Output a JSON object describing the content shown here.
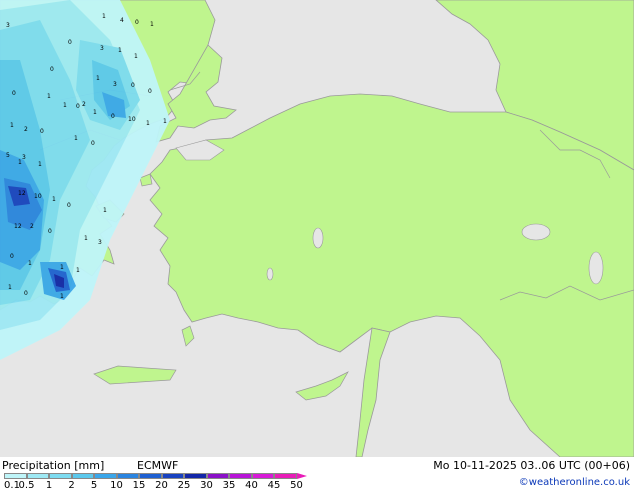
{
  "header": {
    "title": "Precipitation [mm]",
    "model": "ECMWF",
    "valid_time": "Mo 10-11-2025 03..06 UTC (00+06)",
    "credit": "©weatheronline.co.uk"
  },
  "legend": {
    "ticks": [
      "0.1",
      "0.5",
      "1",
      "2",
      "5",
      "10",
      "15",
      "20",
      "25",
      "30",
      "35",
      "40",
      "45",
      "50"
    ],
    "colors": [
      "#bff5f9",
      "#9ee9f4",
      "#7ddbf0",
      "#5bc8ec",
      "#3aa6ea",
      "#2a84e0",
      "#1e60d2",
      "#1842c0",
      "#1226a8",
      "#8a10c8",
      "#b814d8",
      "#d81ad8",
      "#e81cb8"
    ]
  },
  "map": {
    "land_color": "#bff58e",
    "sea_color": "#e6e6e6",
    "border_color": "#9a9a9a",
    "precip_labels": [
      "3",
      "0",
      "1",
      "4",
      "0",
      "1",
      "3",
      "1",
      "1",
      "0",
      "0",
      "1",
      "2",
      "1",
      "0",
      "0",
      "0",
      "3",
      "1",
      "1",
      "0",
      "10",
      "1",
      "1",
      "1",
      "2",
      "0",
      "1",
      "0",
      "1",
      "5",
      "3",
      "1",
      "12",
      "10",
      "1",
      "0",
      "1",
      "1",
      "3",
      "12",
      "2",
      "0",
      "0",
      "1",
      "1",
      "1",
      "1",
      "0",
      "1"
    ]
  }
}
